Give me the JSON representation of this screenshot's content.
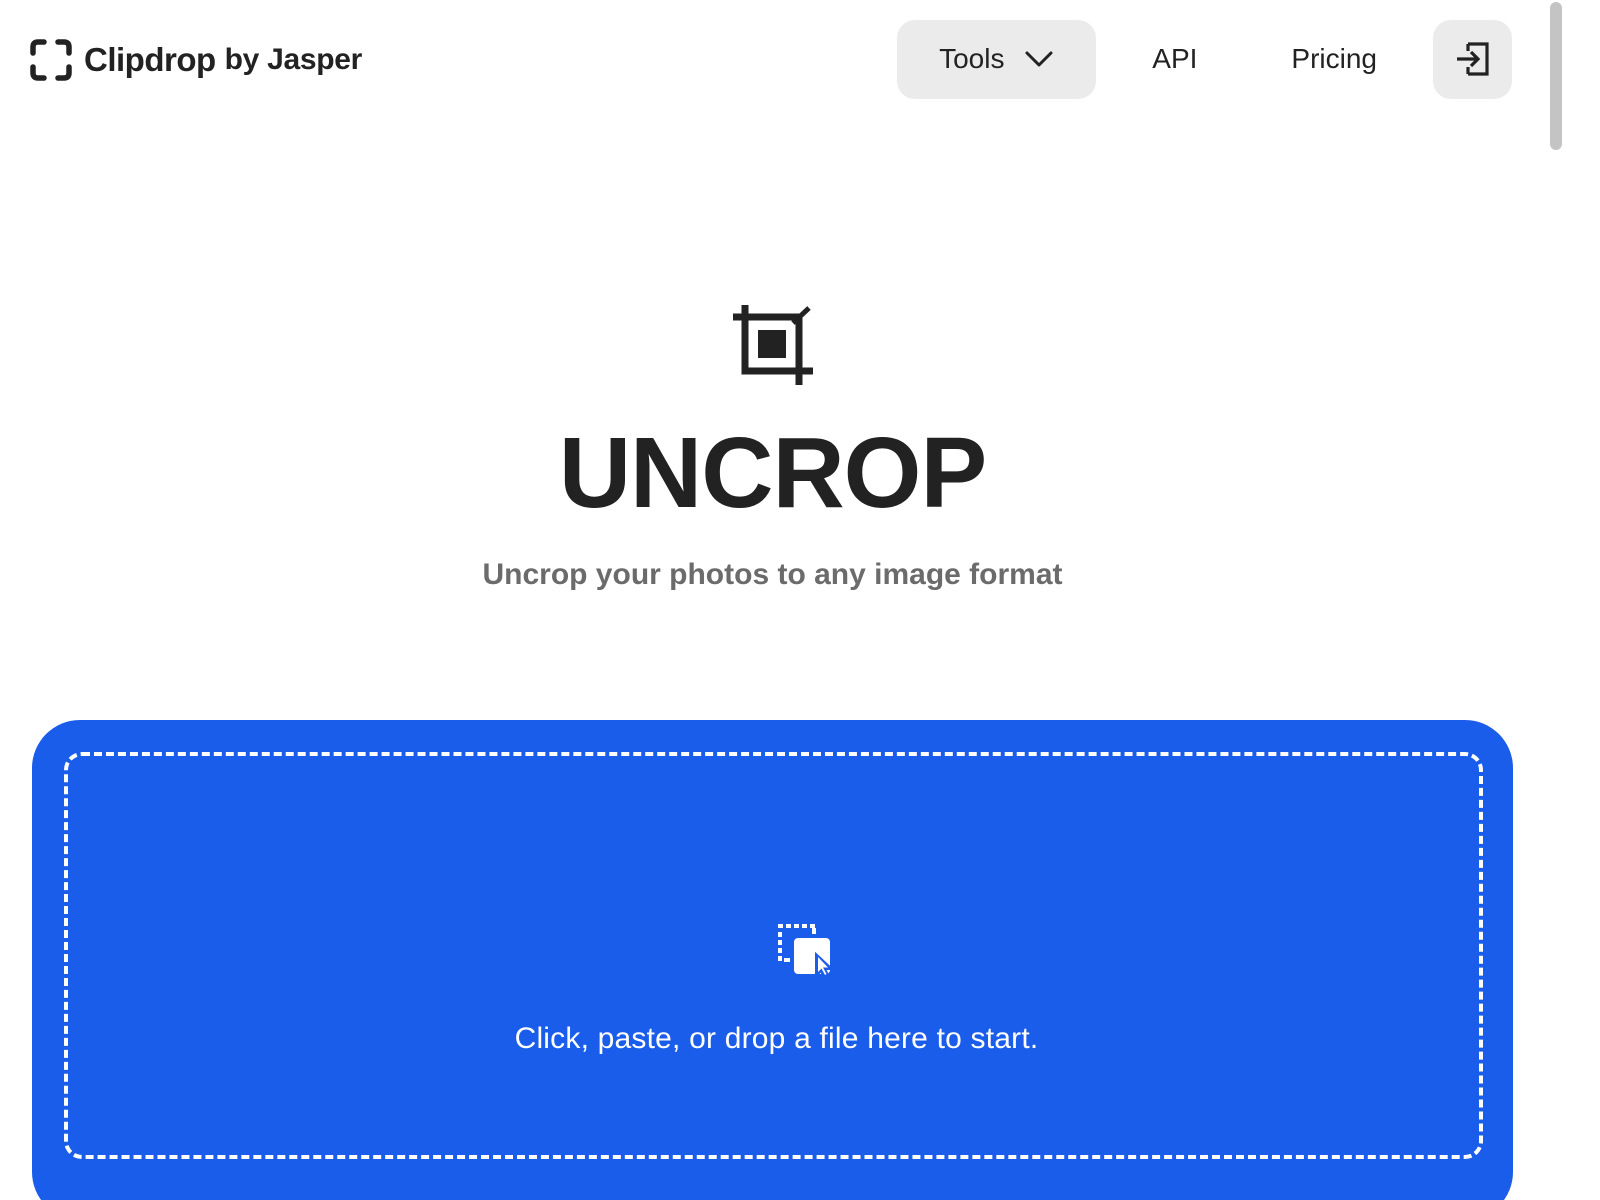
{
  "header": {
    "logo": {
      "name": "Clipdrop",
      "suffix": "by Jasper",
      "icon": "clipdrop-bracket-icon"
    },
    "nav": {
      "tools_label": "Tools",
      "tools_icon": "chevron-down-icon",
      "api_label": "API",
      "pricing_label": "Pricing",
      "login_icon": "login-icon"
    }
  },
  "hero": {
    "icon": "crop-icon",
    "title": "UNCROP",
    "subtitle": "Uncrop your photos to any image format"
  },
  "dropzone": {
    "icon": "select-drop-icon",
    "text": "Click, paste, or drop a file here to start."
  },
  "colors": {
    "accent": "#1b5deb",
    "text": "#222222",
    "muted": "#6b6b6b",
    "nav_button_bg": "#ebebeb"
  }
}
